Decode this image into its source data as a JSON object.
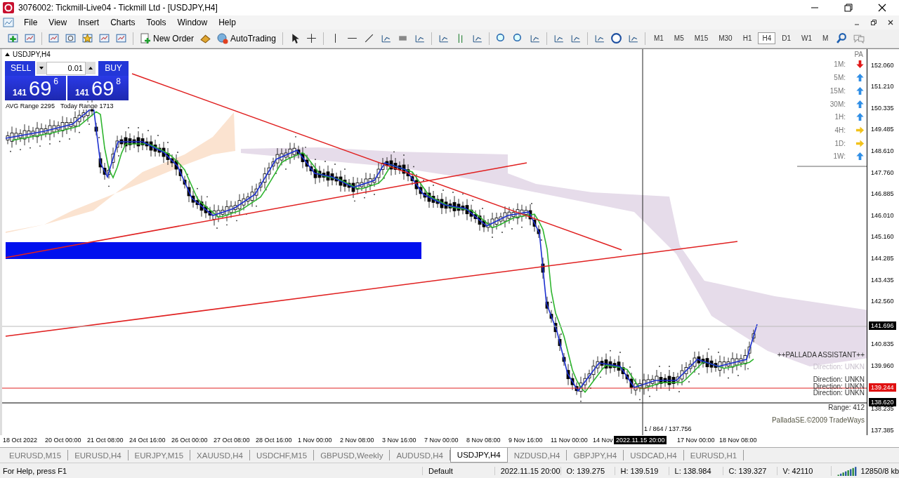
{
  "window": {
    "title": "3076002: Tickmill-Live04 - Tickmill Ltd - [USDJPY,H4]"
  },
  "menu": [
    "File",
    "View",
    "Insert",
    "Charts",
    "Tools",
    "Window",
    "Help"
  ],
  "toolbar": {
    "new_order": "New Order",
    "auto_trading": "AutoTrading",
    "timeframes": [
      {
        "label": "M1",
        "selected": false
      },
      {
        "label": "M5",
        "selected": false
      },
      {
        "label": "M15",
        "selected": false
      },
      {
        "label": "M30",
        "selected": false
      },
      {
        "label": "H1",
        "selected": false
      },
      {
        "label": "H4",
        "selected": true
      },
      {
        "label": "D1",
        "selected": false
      },
      {
        "label": "W1",
        "selected": false
      },
      {
        "label": "M",
        "selected": false
      }
    ]
  },
  "chart": {
    "symbol": "USDJPY,H4",
    "trade_panel": {
      "sell": "SELL",
      "buy": "BUY",
      "lot": "0.01",
      "sell_price": {
        "big_figure": "141",
        "pips": "69",
        "fraction": "6"
      },
      "buy_price": {
        "big_figure": "141",
        "pips": "69",
        "fraction": "8"
      },
      "avg_range": "AVG Range 2295",
      "today_range": "Today Range 1713"
    },
    "pa_panel": {
      "title": "PA",
      "rows": [
        {
          "label": "1M:",
          "kind": "down"
        },
        {
          "label": "5M:",
          "kind": "up"
        },
        {
          "label": "15M:",
          "kind": "up"
        },
        {
          "label": "30M:",
          "kind": "up"
        },
        {
          "label": "1H:",
          "kind": "up"
        },
        {
          "label": "4H:",
          "kind": "right"
        },
        {
          "label": "1D:",
          "kind": "right"
        },
        {
          "label": "1W:",
          "kind": "up"
        }
      ]
    },
    "assistant": {
      "title": "++PALLADA ASSISTANT++",
      "directions": [
        {
          "text": "Direction: UNKN",
          "faded": true
        },
        {
          "text": "Direction: UNKN",
          "faded": false
        },
        {
          "text": "Direction: UNKN",
          "faded": false
        },
        {
          "text": "Direction: UNKN",
          "faded": false
        }
      ],
      "range": "Range: 412",
      "credit": "PalladaSE.©2009 TradeWays"
    },
    "crosshair_readout": "1 / 864 / 137.756",
    "price_axis": [
      "152.060",
      "151.210",
      "150.335",
      "149.485",
      "148.610",
      "147.760",
      "146.885",
      "146.010",
      "145.160",
      "144.285",
      "143.435",
      "142.560",
      "140.835",
      "139.960",
      "138.235",
      "137.385"
    ],
    "price_markers": [
      {
        "label": "141.696",
        "color": "#000000"
      },
      {
        "label": "139.244",
        "color": "#e01010"
      },
      {
        "label": "138.620",
        "color": "#000000"
      }
    ],
    "time_axis": [
      "18 Oct 2022",
      "20 Oct 00:00",
      "21 Oct 08:00",
      "24 Oct 16:00",
      "26 Oct 00:00",
      "27 Oct 08:00",
      "28 Oct 16:00",
      "1 Nov 00:00",
      "2 Nov 08:00",
      "3 Nov 16:00",
      "7 Nov 00:00",
      "8 Nov 08:00",
      "9 Nov 16:00",
      "11 Nov 00:00",
      "14 Nov",
      "17 Nov 00:00",
      "18 Nov 08:00"
    ],
    "crosshair_time": "2022.11.15 20:00"
  },
  "tabs": [
    {
      "label": "EURUSD,M15",
      "selected": false
    },
    {
      "label": "EURUSD,H4",
      "selected": false
    },
    {
      "label": "EURJPY,M15",
      "selected": false
    },
    {
      "label": "XAUUSD,H4",
      "selected": false
    },
    {
      "label": "USDCHF,M15",
      "selected": false
    },
    {
      "label": "GBPUSD,Weekly",
      "selected": false
    },
    {
      "label": "AUDUSD,H4",
      "selected": false
    },
    {
      "label": "USDJPY,H4",
      "selected": true
    },
    {
      "label": "NZDUSD,H4",
      "selected": false
    },
    {
      "label": "GBPJPY,H4",
      "selected": false
    },
    {
      "label": "USDCAD,H4",
      "selected": false
    },
    {
      "label": "EURUSD,H1",
      "selected": false
    }
  ],
  "status_bar": {
    "help": "For Help, press F1",
    "profile": "Default",
    "time": "2022.11.15 20:00",
    "open": "O: 139.275",
    "high": "H: 139.519",
    "low": "L: 138.984",
    "close": "C: 139.327",
    "volume": "V: 42110",
    "traffic": "12850/8 kb"
  }
}
